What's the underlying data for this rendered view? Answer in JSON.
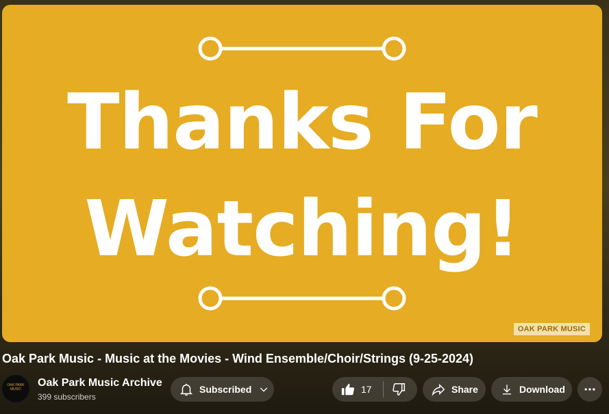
{
  "video": {
    "end_card_line1": "Thanks For",
    "end_card_line2": "Watching!",
    "watermark": "OAK PARK MUSIC",
    "accent_color": "#e5ac24"
  },
  "title": "Oak Park Music - Music at the Movies - Wind Ensemble/Choir/Strings (9-25-2024)",
  "channel": {
    "name": "Oak Park Music Archive",
    "subscribers": "399 subscribers",
    "avatar_text": "OAK PARK MUSIC"
  },
  "actions": {
    "subscribe_label": "Subscribed",
    "like_count": "17",
    "share_label": "Share",
    "download_label": "Download"
  },
  "icons": [
    "bell-icon",
    "chevron-down-icon",
    "thumbs-up-icon",
    "thumbs-down-icon",
    "share-icon",
    "download-icon",
    "more-icon"
  ]
}
